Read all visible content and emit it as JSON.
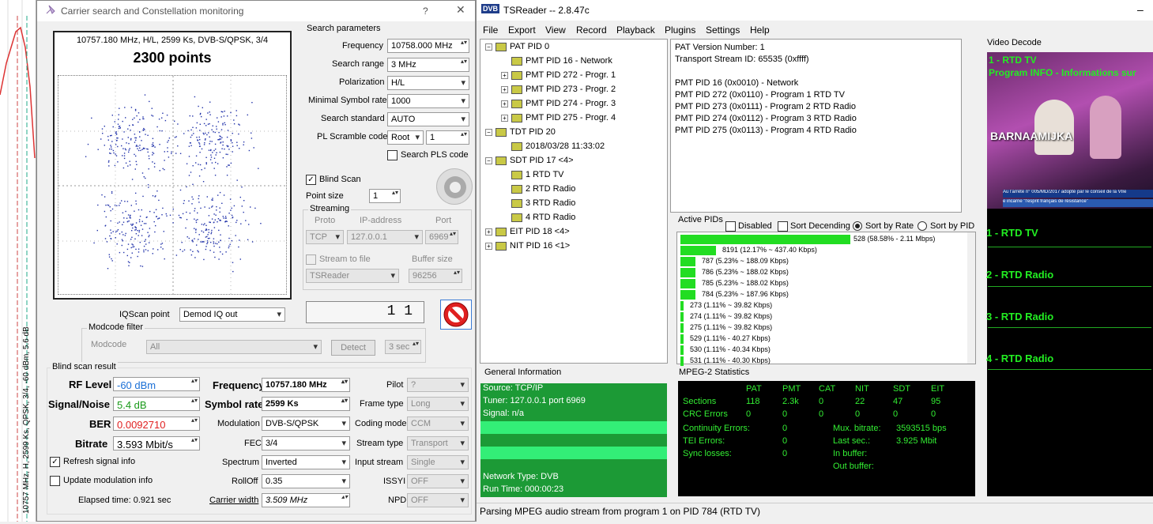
{
  "carrier": {
    "title": "Carrier search and Constellation monitoring",
    "help": "?",
    "close": "✕",
    "plot_header": "10757.180 MHz, H/L, 2599 Ks, DVB-S/QPSK, 3/4",
    "plot_points": "2300 points",
    "search_params": {
      "title": "Search parameters",
      "frequency_label": "Frequency",
      "frequency": "10758.000 MHz",
      "range_label": "Search range",
      "range": "3 MHz",
      "pol_label": "Polarization",
      "pol": "H/L",
      "minsr_label": "Minimal Symbol rate",
      "minsr": "1000",
      "std_label": "Search standard",
      "std": "AUTO",
      "pls_label": "PL Scramble code",
      "pls_mode": "Root",
      "pls_val": "1",
      "pls_search": "Search PLS code"
    },
    "blind_scan": "Blind Scan",
    "point_size_label": "Point size",
    "point_size": "1",
    "streaming": {
      "title": "Streaming",
      "proto_h": "Proto",
      "ip_h": "IP-address",
      "port_h": "Port",
      "proto": "TCP",
      "ip": "127.0.0.1",
      "port": "6969",
      "to_file": "Stream to file",
      "buffer_h": "Buffer size",
      "app": "TSReader",
      "buffer": "96256"
    },
    "iq_label": "IQScan point",
    "iq": "Demod IQ out",
    "lcd": "1 1",
    "modcode": {
      "title": "Modcode filter",
      "label": "Modcode",
      "value": "All",
      "detect": "Detect",
      "time": "3 sec"
    },
    "result": {
      "title": "Blind scan result",
      "rf_label": "RF Level",
      "rf": "-60 dBm",
      "sn_label": "Signal/Noise",
      "sn": "5.4 dB",
      "ber_label": "BER",
      "ber": "0.0092710",
      "br_label": "Bitrate",
      "br": "3.593 Mbit/s",
      "freq_label": "Frequency",
      "freq": "10757.180 MHz",
      "sr_label": "Symbol rate",
      "sr": "2599 Ks",
      "mod_label": "Modulation",
      "mod": "DVB-S/QPSK",
      "fec_label": "FEC",
      "fec": "3/4",
      "spec_label": "Spectrum",
      "spec": "Inverted",
      "roll_label": "RollOff",
      "roll": "0.35",
      "cw_label": "Carrier width",
      "cw": "3.509 MHz",
      "pilot_label": "Pilot",
      "pilot": "?",
      "frame_label": "Frame type",
      "frame": "Long",
      "coding_label": "Coding mode",
      "coding": "CCM",
      "stype_label": "Stream type",
      "stype": "Transport",
      "input_label": "Input stream",
      "input": "Single",
      "issyi_label": "ISSYI",
      "issyi": "OFF",
      "npd_label": "NPD",
      "npd": "OFF",
      "refresh": "Refresh signal info",
      "update": "Update modulation info",
      "elapsed": "Elapsed time: 0.921 sec"
    },
    "side_label": "10757 MHz, H, 2599 Ks, QPSK, 3/4, -60 dBm, 5.6 dB"
  },
  "tsr": {
    "title": "TSReader -- 2.8.47c",
    "logo": "DVB",
    "menu": [
      "File",
      "Export",
      "View",
      "Record",
      "Playback",
      "Plugins",
      "Settings",
      "Help"
    ],
    "tree": [
      {
        "label": "PAT PID 0",
        "icon": "PAT"
      },
      {
        "label": "PMT PID 16 - Network",
        "icon": "PMT"
      },
      {
        "label": "PMT PID 272 - Progr. 1",
        "icon": "PMT"
      },
      {
        "label": "PMT PID 273 - Progr. 2",
        "icon": "PMT"
      },
      {
        "label": "PMT PID 274 - Progr. 3",
        "icon": "PMT"
      },
      {
        "label": "PMT PID 275 - Progr. 4",
        "icon": "PMT"
      },
      {
        "label": "TDT PID 20",
        "icon": "TDT"
      },
      {
        "label": "2018/03/28 11:33:02",
        "icon": "TDT"
      },
      {
        "label": "SDT PID 17 <4>",
        "icon": "SDT"
      },
      {
        "label": "1 RTD TV",
        "icon": "SDT"
      },
      {
        "label": "2 RTD Radio",
        "icon": "SDT"
      },
      {
        "label": "3 RTD Radio",
        "icon": "SDT"
      },
      {
        "label": "4 RTD Radio",
        "icon": "SDT"
      },
      {
        "label": "EIT PID 18 <4>",
        "icon": "EIT"
      },
      {
        "label": "NIT PID 16 <1>",
        "icon": "NIT"
      }
    ],
    "info": [
      "PAT Version Number: 1",
      "Transport Stream ID: 65535 (0xffff)",
      "",
      "PMT PID 16 (0x0010) - Network",
      "PMT PID 272 (0x0110) - Program 1 RTD TV",
      "PMT PID 273 (0x0111) - Program 2 RTD Radio",
      "PMT PID 274 (0x0112) - Program 3 RTD Radio",
      "PMT PID 275 (0x0113) - Program 4 RTD Radio"
    ],
    "active_pids": {
      "title": "Active PIDs",
      "disabled": "Disabled",
      "sort_dec": "Sort Decending",
      "sort_rate": "Sort by Rate",
      "sort_pid": "Sort by PID",
      "bars": [
        {
          "label": "528 (58.58% - 2.11 Mbps)",
          "pct": 58.58
        },
        {
          "label": "8191 (12.17% ~ 437.40 Kbps)",
          "pct": 12.17
        },
        {
          "label": "787 (5.23% ~ 188.09 Kbps)",
          "pct": 5.23
        },
        {
          "label": "786 (5.23% ~ 188.02 Kbps)",
          "pct": 5.23
        },
        {
          "label": "785 (5.23% ~ 188.02 Kbps)",
          "pct": 5.23
        },
        {
          "label": "784 (5.23% ~ 187.96 Kbps)",
          "pct": 5.23
        },
        {
          "label": "273 (1.11% ~ 39.82 Kbps)",
          "pct": 1.11
        },
        {
          "label": "274 (1.11% ~ 39.82 Kbps)",
          "pct": 1.11
        },
        {
          "label": "275 (1.11% ~ 39.82 Kbps)",
          "pct": 1.11
        },
        {
          "label": "529 (1.11% - 40.27 Kbps)",
          "pct": 1.11
        },
        {
          "label": "530 (1.11% - 40.34 Kbps)",
          "pct": 1.11
        },
        {
          "label": "531 (1.11% - 40.30 Kbps)",
          "pct": 1.11
        }
      ]
    },
    "general": {
      "title": "General Information",
      "rows": [
        "Source: TCP/IP",
        "Tuner: 127.0.0.1 port 6969",
        "Signal: n/a",
        "",
        "",
        "",
        "",
        "Network Type: DVB",
        "Run Time: 000:00:23"
      ]
    },
    "mpeg": {
      "title": "MPEG-2 Statistics",
      "headers": [
        "PAT",
        "PMT",
        "CAT",
        "NIT",
        "SDT",
        "EIT"
      ],
      "sections_label": "Sections",
      "sections": [
        "118",
        "2.3k",
        "0",
        "22",
        "47",
        "95"
      ],
      "crc_label": "CRC Errors",
      "crc": [
        "0",
        "0",
        "0",
        "0",
        "0",
        "0"
      ],
      "cont_label": "Continuity Errors:",
      "cont": "0",
      "tei_label": "TEI Errors:",
      "tei": "0",
      "sync_label": "Sync losses:",
      "sync": "0",
      "mux_label": "Mux. bitrate:",
      "mux": "3593515 bps",
      "last_label": "Last sec.:",
      "last": "3.925 Mbit",
      "inbuf_label": "In buffer:",
      "outbuf_label": "Out buffer:"
    },
    "video": {
      "title": "Video Decode",
      "overlay1": "1 - RTD TV",
      "overlay2": "Program INFO - Informations sur",
      "banner": "BARNAAMIJKA",
      "ticker1": "Au l'arrêté n° 005/MD/2017 adopté par le conseil de la VIIe",
      "ticker2": "e incarne \"l'esprit français de résistance\"",
      "channels": [
        "1 - RTD TV",
        "2 - RTD Radio",
        "3 - RTD Radio",
        "4 - RTD Radio"
      ]
    },
    "status": "Parsing MPEG audio stream from program 1 on PID 784 (RTD TV)"
  }
}
